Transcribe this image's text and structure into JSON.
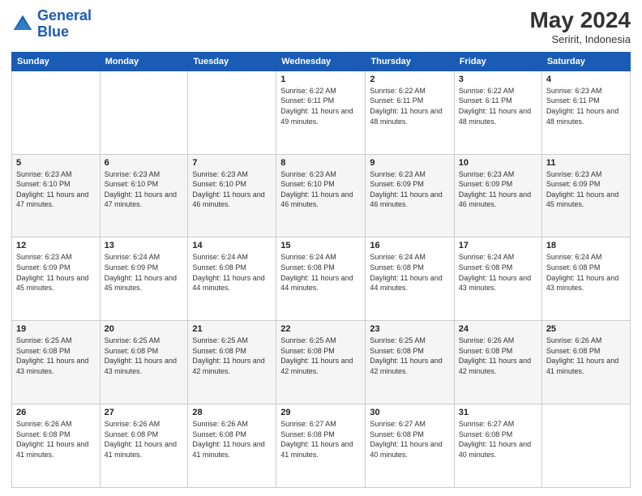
{
  "header": {
    "logo_line1": "General",
    "logo_line2": "Blue",
    "month_year": "May 2024",
    "location": "Seririt, Indonesia"
  },
  "days_of_week": [
    "Sunday",
    "Monday",
    "Tuesday",
    "Wednesday",
    "Thursday",
    "Friday",
    "Saturday"
  ],
  "weeks": [
    [
      {
        "num": "",
        "info": ""
      },
      {
        "num": "",
        "info": ""
      },
      {
        "num": "",
        "info": ""
      },
      {
        "num": "1",
        "info": "Sunrise: 6:22 AM\nSunset: 6:11 PM\nDaylight: 11 hours and 49 minutes."
      },
      {
        "num": "2",
        "info": "Sunrise: 6:22 AM\nSunset: 6:11 PM\nDaylight: 11 hours and 48 minutes."
      },
      {
        "num": "3",
        "info": "Sunrise: 6:22 AM\nSunset: 6:11 PM\nDaylight: 11 hours and 48 minutes."
      },
      {
        "num": "4",
        "info": "Sunrise: 6:23 AM\nSunset: 6:11 PM\nDaylight: 11 hours and 48 minutes."
      }
    ],
    [
      {
        "num": "5",
        "info": "Sunrise: 6:23 AM\nSunset: 6:10 PM\nDaylight: 11 hours and 47 minutes."
      },
      {
        "num": "6",
        "info": "Sunrise: 6:23 AM\nSunset: 6:10 PM\nDaylight: 11 hours and 47 minutes."
      },
      {
        "num": "7",
        "info": "Sunrise: 6:23 AM\nSunset: 6:10 PM\nDaylight: 11 hours and 46 minutes."
      },
      {
        "num": "8",
        "info": "Sunrise: 6:23 AM\nSunset: 6:10 PM\nDaylight: 11 hours and 46 minutes."
      },
      {
        "num": "9",
        "info": "Sunrise: 6:23 AM\nSunset: 6:09 PM\nDaylight: 11 hours and 46 minutes."
      },
      {
        "num": "10",
        "info": "Sunrise: 6:23 AM\nSunset: 6:09 PM\nDaylight: 11 hours and 46 minutes."
      },
      {
        "num": "11",
        "info": "Sunrise: 6:23 AM\nSunset: 6:09 PM\nDaylight: 11 hours and 45 minutes."
      }
    ],
    [
      {
        "num": "12",
        "info": "Sunrise: 6:23 AM\nSunset: 6:09 PM\nDaylight: 11 hours and 45 minutes."
      },
      {
        "num": "13",
        "info": "Sunrise: 6:24 AM\nSunset: 6:09 PM\nDaylight: 11 hours and 45 minutes."
      },
      {
        "num": "14",
        "info": "Sunrise: 6:24 AM\nSunset: 6:08 PM\nDaylight: 11 hours and 44 minutes."
      },
      {
        "num": "15",
        "info": "Sunrise: 6:24 AM\nSunset: 6:08 PM\nDaylight: 11 hours and 44 minutes."
      },
      {
        "num": "16",
        "info": "Sunrise: 6:24 AM\nSunset: 6:08 PM\nDaylight: 11 hours and 44 minutes."
      },
      {
        "num": "17",
        "info": "Sunrise: 6:24 AM\nSunset: 6:08 PM\nDaylight: 11 hours and 43 minutes."
      },
      {
        "num": "18",
        "info": "Sunrise: 6:24 AM\nSunset: 6:08 PM\nDaylight: 11 hours and 43 minutes."
      }
    ],
    [
      {
        "num": "19",
        "info": "Sunrise: 6:25 AM\nSunset: 6:08 PM\nDaylight: 11 hours and 43 minutes."
      },
      {
        "num": "20",
        "info": "Sunrise: 6:25 AM\nSunset: 6:08 PM\nDaylight: 11 hours and 43 minutes."
      },
      {
        "num": "21",
        "info": "Sunrise: 6:25 AM\nSunset: 6:08 PM\nDaylight: 11 hours and 42 minutes."
      },
      {
        "num": "22",
        "info": "Sunrise: 6:25 AM\nSunset: 6:08 PM\nDaylight: 11 hours and 42 minutes."
      },
      {
        "num": "23",
        "info": "Sunrise: 6:25 AM\nSunset: 6:08 PM\nDaylight: 11 hours and 42 minutes."
      },
      {
        "num": "24",
        "info": "Sunrise: 6:26 AM\nSunset: 6:08 PM\nDaylight: 11 hours and 42 minutes."
      },
      {
        "num": "25",
        "info": "Sunrise: 6:26 AM\nSunset: 6:08 PM\nDaylight: 11 hours and 41 minutes."
      }
    ],
    [
      {
        "num": "26",
        "info": "Sunrise: 6:26 AM\nSunset: 6:08 PM\nDaylight: 11 hours and 41 minutes."
      },
      {
        "num": "27",
        "info": "Sunrise: 6:26 AM\nSunset: 6:08 PM\nDaylight: 11 hours and 41 minutes."
      },
      {
        "num": "28",
        "info": "Sunrise: 6:26 AM\nSunset: 6:08 PM\nDaylight: 11 hours and 41 minutes."
      },
      {
        "num": "29",
        "info": "Sunrise: 6:27 AM\nSunset: 6:08 PM\nDaylight: 11 hours and 41 minutes."
      },
      {
        "num": "30",
        "info": "Sunrise: 6:27 AM\nSunset: 6:08 PM\nDaylight: 11 hours and 40 minutes."
      },
      {
        "num": "31",
        "info": "Sunrise: 6:27 AM\nSunset: 6:08 PM\nDaylight: 11 hours and 40 minutes."
      },
      {
        "num": "",
        "info": ""
      }
    ]
  ]
}
